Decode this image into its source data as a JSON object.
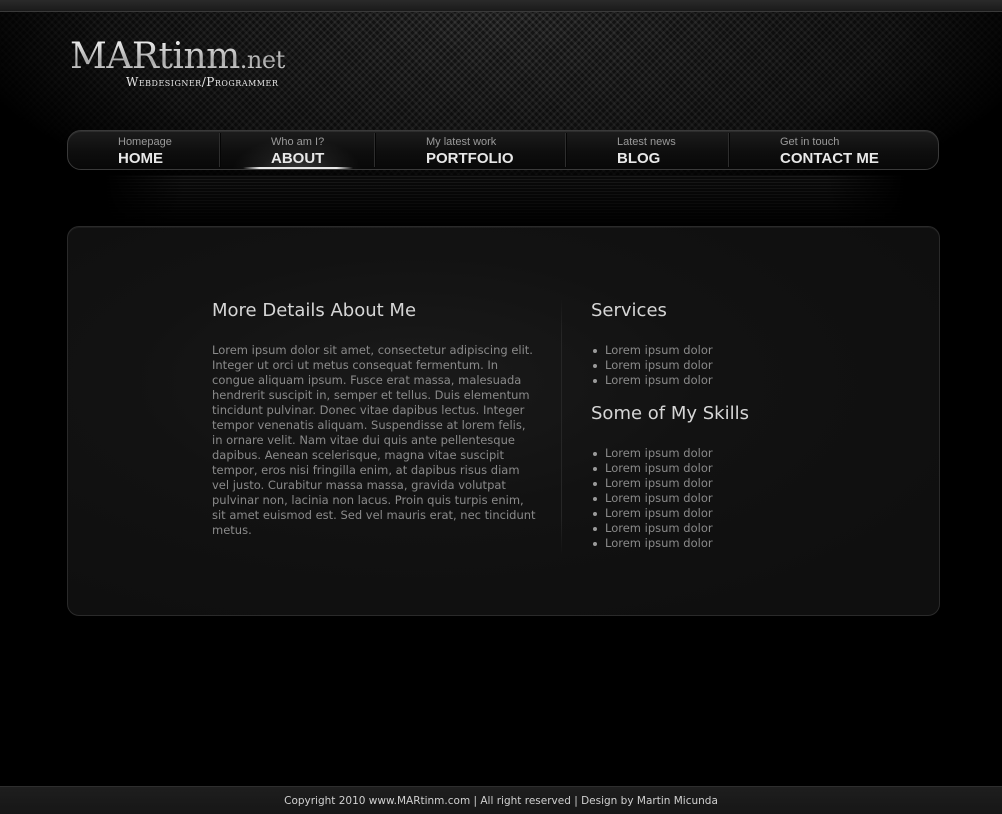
{
  "logo": {
    "main": "MARtinm",
    "suffix": ".net",
    "tagline": "Webdesigner/Programmer"
  },
  "nav": {
    "items": [
      {
        "sub": "Homepage",
        "label": "HOME"
      },
      {
        "sub": "Who am I?",
        "label": "ABOUT"
      },
      {
        "sub": "My latest work",
        "label": "PORTFOLIO"
      },
      {
        "sub": "Latest news",
        "label": "BLOG"
      },
      {
        "sub": "Get in touch",
        "label": "CONTACT ME"
      }
    ],
    "active": "ABOUT"
  },
  "about": {
    "title": "More Details About Me",
    "text": "Lorem ipsum dolor sit amet, consectetur adipiscing elit. Integer ut orci ut metus consequat fermentum. In congue aliquam ipsum. Fusce erat massa, malesuada hendrerit suscipit in, semper et tellus. Duis elementum tincidunt pulvinar. Donec vitae dapibus lectus. Integer tempor venenatis aliquam. Suspendisse at lorem felis, in ornare velit. Nam vitae dui quis ante pellentesque dapibus. Aenean scelerisque, magna vitae suscipit tempor, eros nisi fringilla enim, at dapibus risus diam vel justo. Curabitur massa massa, gravida volutpat pulvinar non, lacinia non lacus. Proin quis turpis enim, sit amet euismod est. Sed vel mauris erat, nec tincidunt metus."
  },
  "services": {
    "title": "Services",
    "items": [
      "Lorem ipsum dolor",
      "Lorem ipsum dolor",
      "Lorem ipsum dolor"
    ]
  },
  "skills": {
    "title": "Some of My Skills",
    "items": [
      "Lorem ipsum dolor",
      "Lorem ipsum dolor",
      "Lorem ipsum dolor",
      "Lorem ipsum dolor",
      "Lorem ipsum dolor",
      "Lorem ipsum dolor",
      "Lorem ipsum dolor"
    ]
  },
  "footer": {
    "text": "Copyright 2010 www.MARtinm.com | All right reserved | Design by Martin Micunda"
  },
  "colors": {
    "background": "#000000",
    "panel": "#121212",
    "heading": "#d6d6d6",
    "body_text": "#8a8a8a",
    "nav_text": "#e8e8e8"
  }
}
